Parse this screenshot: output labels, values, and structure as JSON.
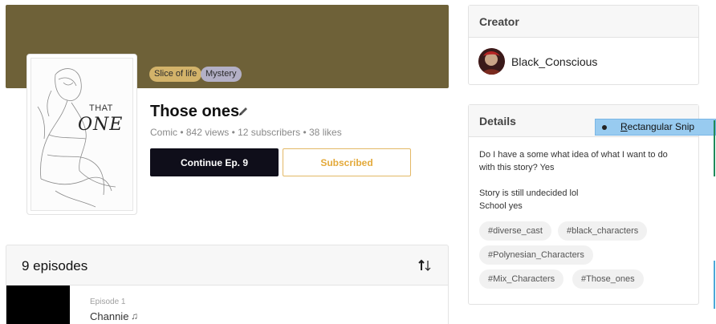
{
  "series": {
    "cover_title_1": "THAT",
    "cover_title_2": "ONE",
    "genres": [
      "Slice of life",
      "Mystery"
    ],
    "title": "Those ones",
    "meta": "Comic • 842 views • 12 subscribers • 38 likes",
    "continue_label": "Continue Ep. 9",
    "subscribed_label": "Subscribed"
  },
  "episodes": {
    "count_label": "9 episodes",
    "items": [
      {
        "number": "Episode 1",
        "title": "Channie",
        "note": "♫"
      }
    ]
  },
  "creator": {
    "heading": "Creator",
    "name": "Black_Conscious"
  },
  "details": {
    "heading": "Details",
    "description_lines": [
      "Do I have a some what idea of what I want to do",
      "with this story? Yes",
      "",
      "Story is still undecided lol",
      "School yes"
    ],
    "tags": [
      "#diverse_cast",
      "#black_characters",
      "#Polynesian_Characters",
      "#Mix_Characters",
      "#Those_ones"
    ]
  },
  "snip_popup": {
    "label_first": "R",
    "label_rest": "ectangular Snip"
  },
  "colors": {
    "banner": "#6e6138",
    "genre_slice": "#d3b36a",
    "genre_mystery": "#b3b0c6",
    "accent_subscribed": "#e3a93a",
    "continue_bg": "#0f0e1a",
    "snip_bg": "#98cbf0"
  }
}
